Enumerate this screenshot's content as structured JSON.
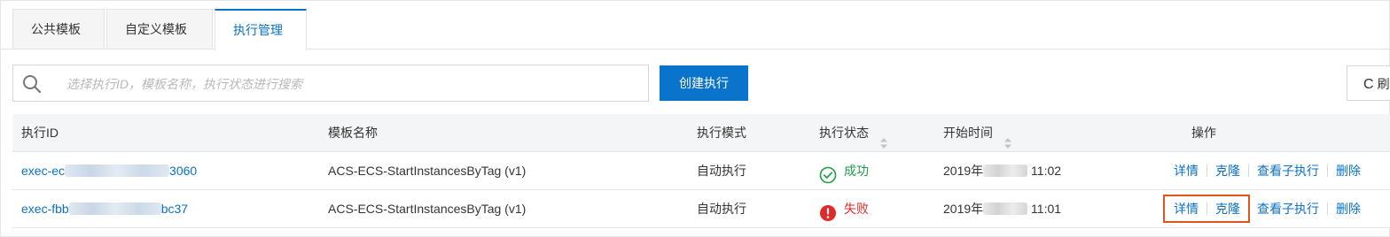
{
  "tabs": [
    {
      "label": "公共模板",
      "active": false
    },
    {
      "label": "自定义模板",
      "active": false
    },
    {
      "label": "执行管理",
      "active": true
    }
  ],
  "search": {
    "placeholder": "选择执行ID，模板名称，执行状态进行搜索",
    "icon": "search-icon"
  },
  "toolbar": {
    "create_label": "创建执行",
    "refresh_glyph": "C",
    "refresh_label": "刷"
  },
  "table": {
    "headers": {
      "id": "执行ID",
      "template": "模板名称",
      "mode": "执行模式",
      "status": "执行状态",
      "start_time": "开始时间",
      "actions": "操作"
    },
    "rows": [
      {
        "id_prefix": "exec-ec",
        "id_suffix": "3060",
        "template": "ACS-ECS-StartInstancesByTag (v1)",
        "mode": "自动执行",
        "status": "成功",
        "status_type": "success",
        "time_prefix": "2019年",
        "time_suffix": "11:02"
      },
      {
        "id_prefix": "exec-fbb",
        "id_suffix": "bc37",
        "template": "ACS-ECS-StartInstancesByTag (v1)",
        "mode": "自动执行",
        "status": "失败",
        "status_type": "failed",
        "time_prefix": "2019年",
        "time_suffix": "11:01"
      }
    ],
    "actions": {
      "detail": "详情",
      "clone": "克隆",
      "view_children": "查看子执行",
      "delete": "删除"
    }
  },
  "colors": {
    "accent": "#0a72c9",
    "primary_button": "#0a73cc",
    "success": "#1e9e45",
    "failed": "#e02a2a",
    "highlight_box": "#e2541c"
  }
}
